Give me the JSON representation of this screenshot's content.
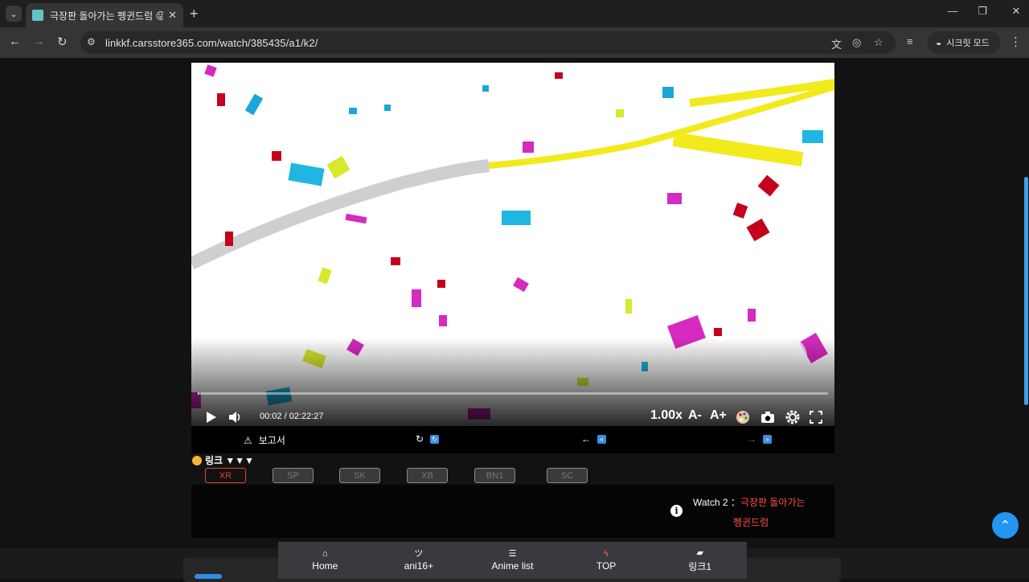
{
  "browser": {
    "tab_title": "극장판 돌아가는 펭귄드럼 😜",
    "url": "linkkf.carsstore365.com/watch/385435/a1/k2/",
    "incognito_label": "시크릿 모드"
  },
  "player": {
    "time": "00:02 / 02:22:27",
    "speed": "1.00x",
    "font_decrease": "A-",
    "font_increase": "A+",
    "progress": 0.001
  },
  "controls": {
    "report_label": "보고서"
  },
  "links": {
    "heading": "링크 ▼▼▼",
    "servers": [
      "XR",
      "SP",
      "SK",
      "XB",
      "BN1",
      "SC"
    ]
  },
  "watch": {
    "prefix": "Watch 2 ：",
    "title_line1": "극장판 돌아가는",
    "title_line2": "펭귄드럼"
  },
  "bottom_nav": {
    "items": [
      {
        "icon": "home-icon",
        "label": "Home"
      },
      {
        "icon": "tsu-icon",
        "glyph": "ツ",
        "label": "ani16+"
      },
      {
        "icon": "list-icon",
        "label": "Anime list"
      },
      {
        "icon": "bolt-icon",
        "label": "TOP"
      },
      {
        "icon": "link-icon",
        "label": "링크1"
      }
    ]
  },
  "colors": {
    "accent_blue": "#2196f3",
    "active_server": "#e2462a",
    "watch_title": "#ff5040"
  }
}
